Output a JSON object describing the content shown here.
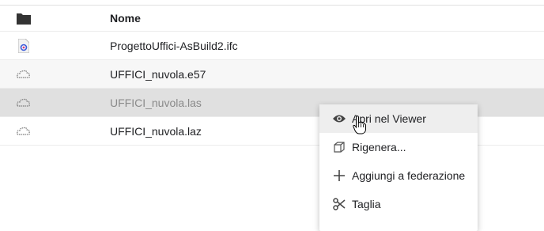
{
  "table": {
    "header": {
      "name_label": "Nome",
      "icon": "folder-icon"
    },
    "rows": [
      {
        "name": "ProgettoUffici-AsBuild2.ifc",
        "icon": "ifc-file-icon"
      },
      {
        "name": "UFFICI_nuvola.e57",
        "icon": "point-cloud-icon"
      },
      {
        "name": "UFFICI_nuvola.las",
        "icon": "point-cloud-icon",
        "selected": true
      },
      {
        "name": "UFFICI_nuvola.laz",
        "icon": "point-cloud-icon"
      }
    ]
  },
  "context_menu": {
    "items": [
      {
        "label": "Apri nel Viewer",
        "icon": "eye-icon"
      },
      {
        "label": "Rigenera...",
        "icon": "cube-icon"
      },
      {
        "label": "Aggiungi a federazione",
        "icon": "plus-icon"
      },
      {
        "label": "Taglia",
        "icon": "scissors-icon"
      }
    ]
  },
  "colors": {
    "selected_row": "#e0e0e0",
    "menu_hover": "#eeeeee",
    "ifc_accent": "#3b5bdb"
  }
}
